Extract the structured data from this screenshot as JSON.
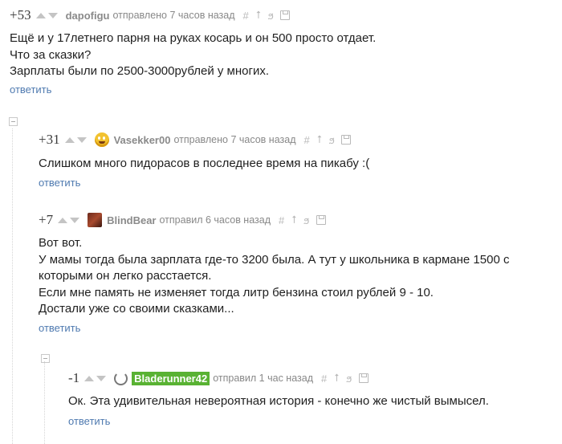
{
  "comments": [
    {
      "rating": "+53",
      "user": "dapofigu",
      "meta": "отправлено 7 часов назад",
      "lines": [
        "Ещё и у 17летнего парня на руках косарь и он 500 просто отдает.",
        "Что за сказки?",
        "Зарплаты были по 2500-3000рублей у многих."
      ],
      "reply": "ответить"
    },
    {
      "rating": "+31",
      "user": "Vasekker00",
      "meta": "отправлено 7 часов назад",
      "lines": [
        "Слишком много пидорасов в последнее время на пикабу :("
      ],
      "reply": "ответить"
    },
    {
      "rating": "+7",
      "user": "BlindBear",
      "meta": "отправил 6 часов назад",
      "lines": [
        "Вот вот.",
        "У мамы тогда была зарплата где-то 3200 была. А тут у школьника в кармане 1500 с",
        "которыми он легко расстается.",
        "Если мне память не изменяет тогда литр бензина стоил рублей 9 - 10.",
        "Достали уже со своими сказками..."
      ],
      "reply": "ответить"
    },
    {
      "rating": "-1",
      "user": "Bladerunner42",
      "meta": "отправил 1 час назад",
      "lines": [
        "Ок. Эта удивительная невероятная история - конечно же чистый вымысел."
      ],
      "reply": "ответить"
    }
  ],
  "icons": [
    "hash-icon",
    "pin-up-icon",
    "branch-icon",
    "save-icon"
  ],
  "colors": {
    "link": "#4f7ab0",
    "meta": "#888888",
    "highlight_user": "#59b233"
  }
}
